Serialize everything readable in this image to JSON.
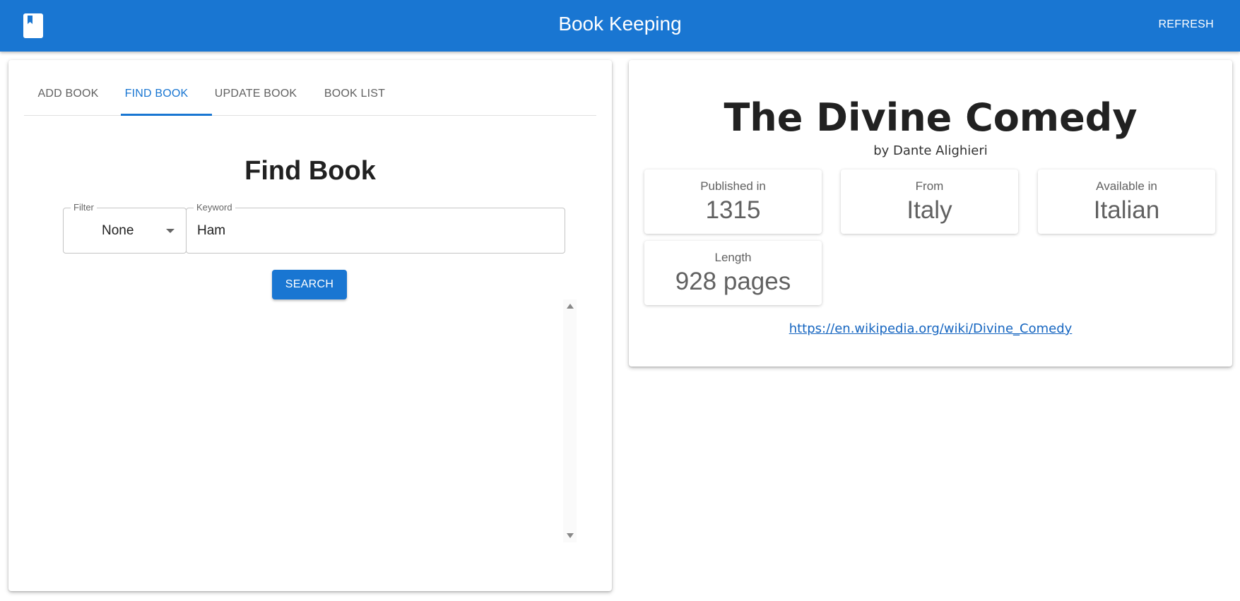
{
  "appbar": {
    "title": "Book Keeping",
    "refresh_label": "REFRESH",
    "logo_icon": "book-icon",
    "color": "#1976d2"
  },
  "tabs": [
    {
      "label": "ADD BOOK",
      "active": false
    },
    {
      "label": "FIND BOOK",
      "active": true
    },
    {
      "label": "UPDATE BOOK",
      "active": false
    },
    {
      "label": "BOOK LIST",
      "active": false
    }
  ],
  "find": {
    "heading": "Find Book",
    "filter_label": "Filter",
    "filter_value": "None",
    "keyword_label": "Keyword",
    "keyword_value": "Ham",
    "search_label": "SEARCH"
  },
  "book": {
    "title": "The Divine Comedy",
    "author": "by Dante Alighieri",
    "published_label": "Published in",
    "published_value": "1315",
    "from_label": "From",
    "from_value": "Italy",
    "language_label": "Available in",
    "language_value": "Italian",
    "length_label": "Length",
    "length_value": "928 pages",
    "link": "https://en.wikipedia.org/wiki/Divine_Comedy"
  }
}
